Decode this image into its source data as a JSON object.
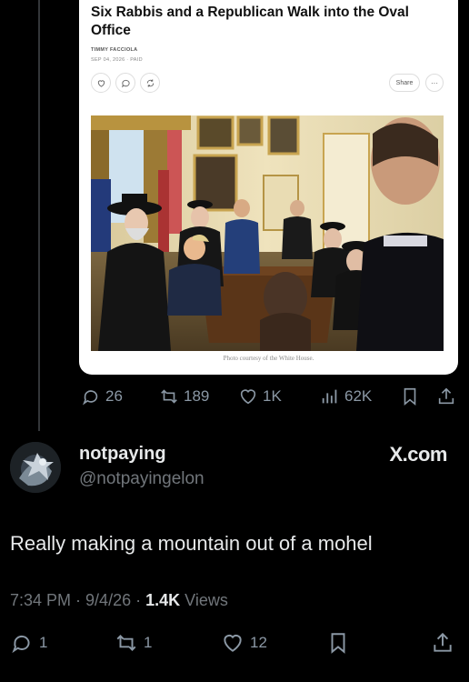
{
  "quoted_article": {
    "title": "Six Rabbis and a Republican Walk into the Oval Office",
    "author": "TIMMY FACCIOLA",
    "date_line": "SEP 04, 2026 · PAID",
    "share_label": "Share",
    "more_label": "···",
    "photo_caption": "Photo courtesy of the White House."
  },
  "quoted_stats": {
    "replies": "26",
    "reposts": "189",
    "likes": "1K",
    "views": "62K"
  },
  "author": {
    "display_name": "notpaying",
    "handle": "@notpayingelon",
    "source_label": "X.com"
  },
  "tweet": {
    "text": "Really making a mountain out of a mohel",
    "time": "7:34 PM",
    "date": "9/4/26",
    "views_count": "1.4K",
    "views_label": "Views"
  },
  "actions": {
    "replies": "1",
    "reposts": "1",
    "likes": "12"
  },
  "colors": {
    "background": "#000000",
    "text_primary": "#e7e9ea",
    "text_secondary": "#71767b",
    "icon_gray": "#8b98a5"
  },
  "icons": [
    "heart-icon",
    "comment-icon",
    "restack-icon",
    "reply-icon",
    "repost-icon",
    "like-icon",
    "views-icon",
    "bookmark-icon",
    "share-icon"
  ]
}
